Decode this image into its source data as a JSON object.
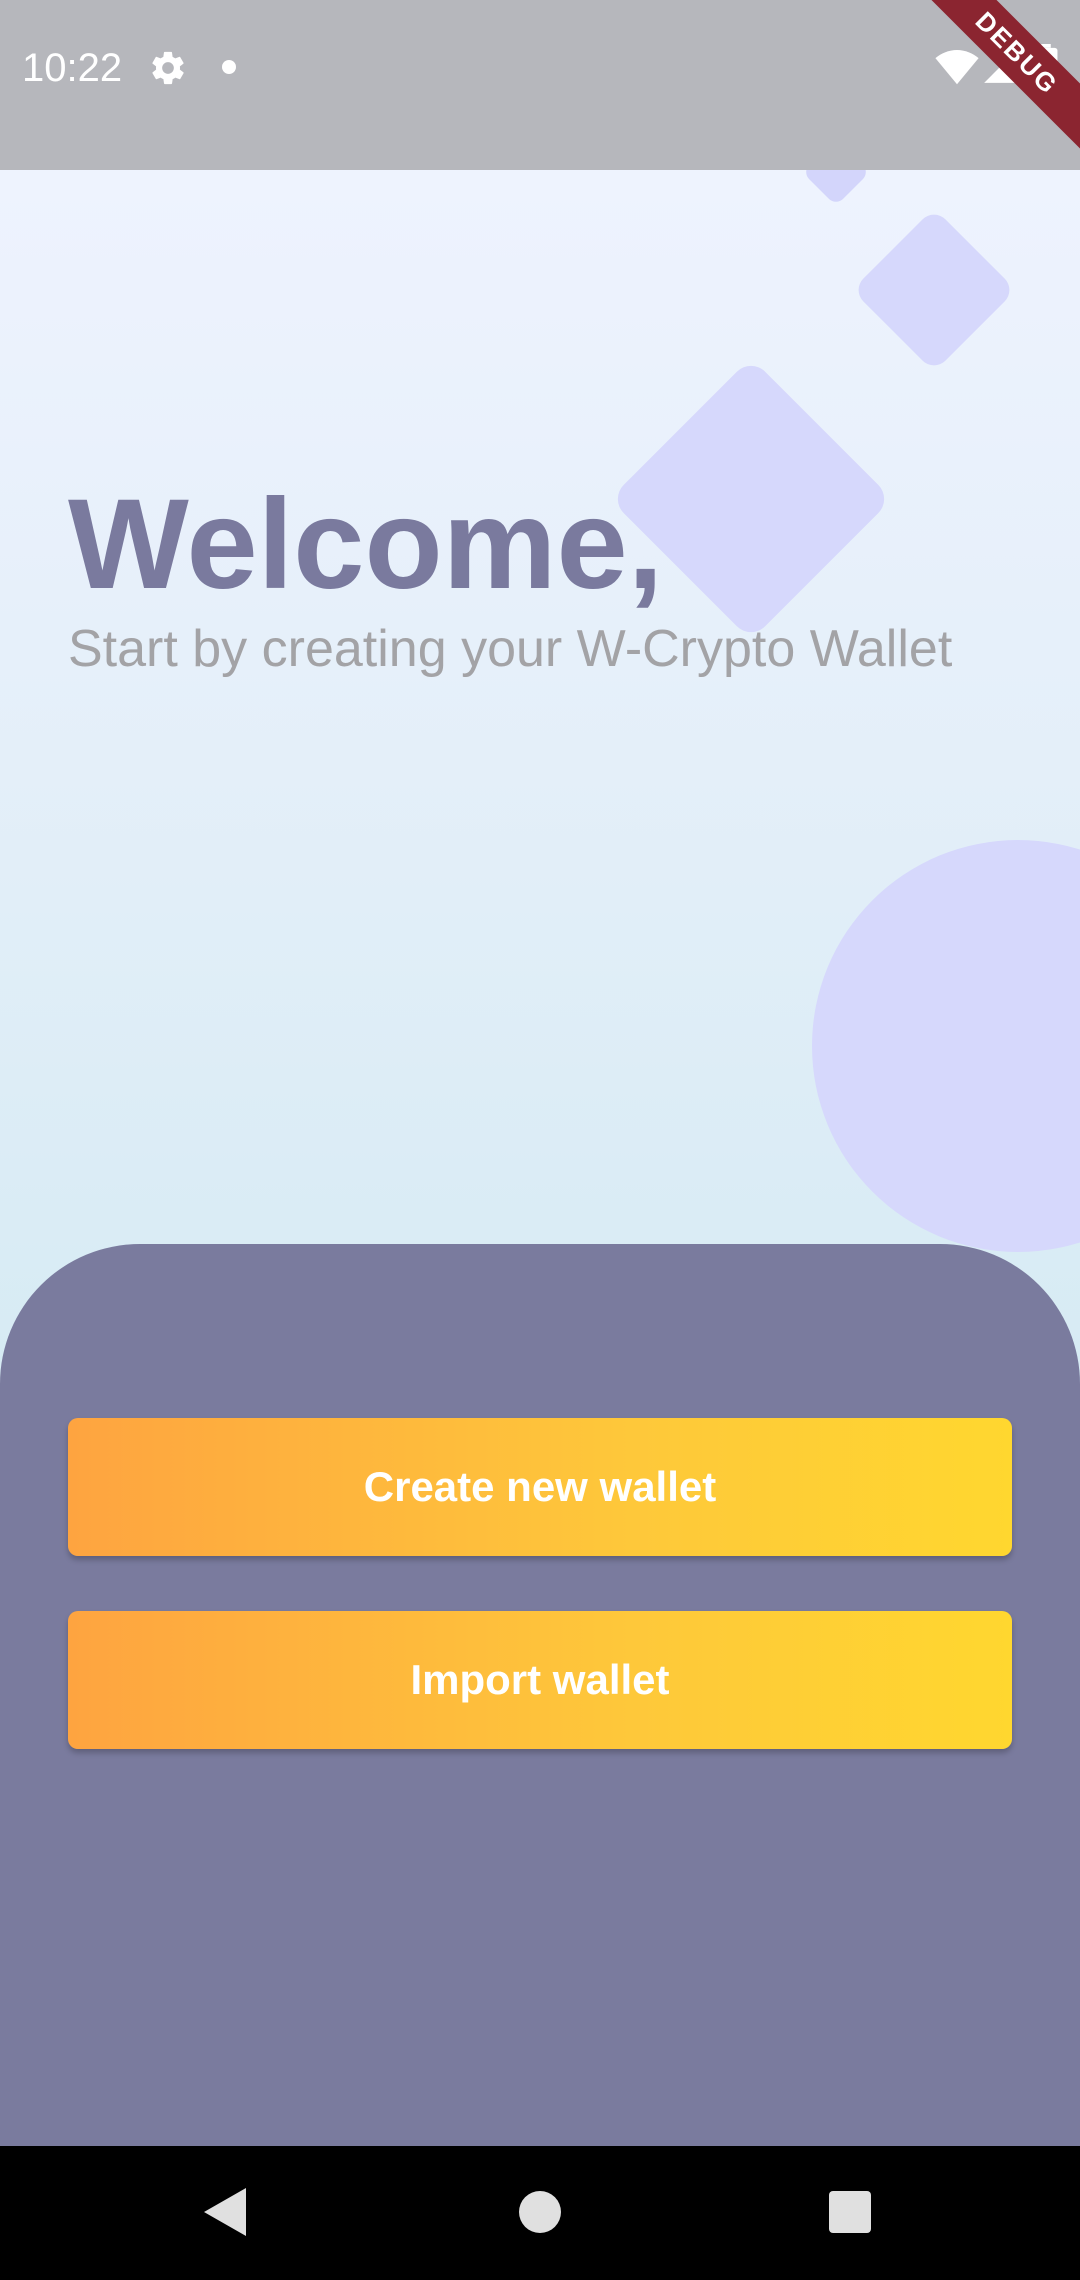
{
  "status_bar": {
    "time": "10:22",
    "icons": [
      "gear-icon",
      "notification-dot-icon",
      "wifi-icon",
      "signal-icon",
      "battery-icon"
    ]
  },
  "debug_banner": "DEBUG",
  "welcome": {
    "title": "Welcome,",
    "subtitle": "Start by creating your W-Crypto Wallet"
  },
  "actions": {
    "create_label": "Create new wallet",
    "import_label": "Import wallet"
  },
  "navigation": {
    "buttons": [
      "back-icon",
      "home-icon",
      "recents-icon"
    ]
  },
  "colors": {
    "title": "#7a7a9e",
    "subtitle": "#a3a3a6",
    "panel": "#7a7b9e",
    "button_gradient_start": "#fea440",
    "button_gradient_end": "#ffd72f",
    "decoration": "#d6d8fc",
    "status_bar": "#b6b7bc"
  }
}
